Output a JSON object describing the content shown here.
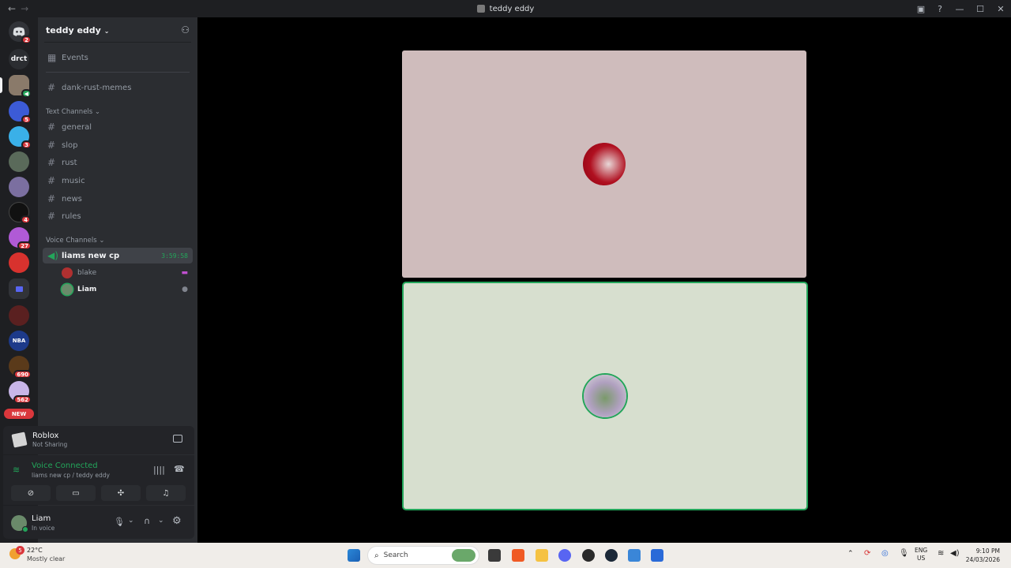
{
  "window": {
    "title": "teddy eddy"
  },
  "guilds": {
    "dm_label": "drct",
    "home_badge": "2",
    "badges": [
      "5",
      "3",
      "4",
      "27",
      "690",
      "562"
    ],
    "new_label": "NEW"
  },
  "server": {
    "name": "teddy eddy",
    "events_label": "Events",
    "pinned_channel": "dank-rust-memes",
    "text_category": "Text Channels",
    "text_channels": [
      "general",
      "slop",
      "rust",
      "music",
      "news",
      "rules"
    ],
    "voice_category": "Voice Channels",
    "voice_channel": {
      "name": "liams new cp",
      "timer": "3:59:58"
    },
    "voice_users": [
      "blake",
      "Liam"
    ]
  },
  "activity": {
    "app": "Roblox",
    "status": "Not Sharing"
  },
  "voice": {
    "status": "Voice Connected",
    "location": "liams new cp / teddy eddy"
  },
  "user": {
    "name": "Liam",
    "status": "In voice"
  },
  "taskbar": {
    "weather_temp": "22°C",
    "weather_desc": "Mostly clear",
    "weather_badge": "5",
    "search_placeholder": "Search",
    "lang1": "ENG",
    "lang2": "US",
    "time": "9:10 PM",
    "date": "24/03/2026"
  },
  "colors": {
    "accent_green": "#23a55a",
    "tile_top": "#cfbcbc",
    "tile_bottom": "#d7dfcf"
  }
}
